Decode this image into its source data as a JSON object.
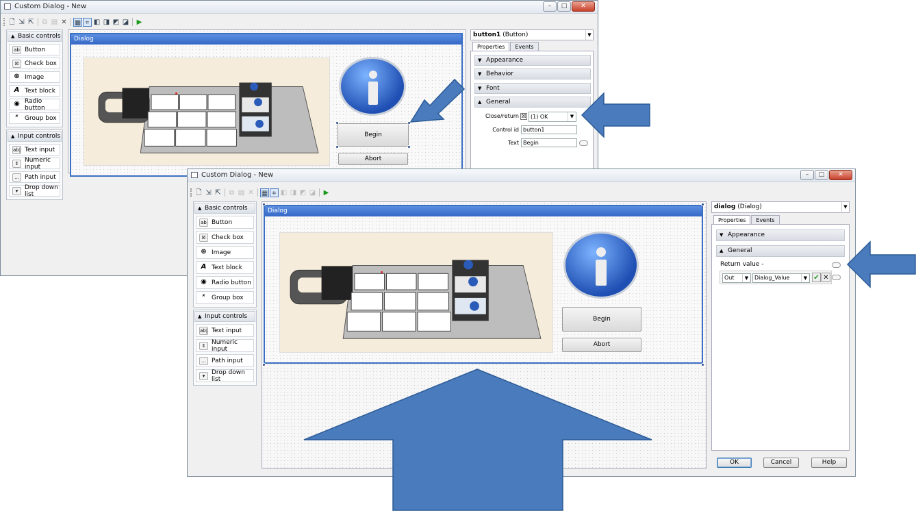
{
  "window1": {
    "title": "Custom Dialog - New",
    "palette": {
      "basic_header": "Basic controls",
      "basic_items": [
        {
          "icon": "ab",
          "label": "Button"
        },
        {
          "icon": "☒",
          "label": "Check box"
        },
        {
          "icon": "⊛",
          "label": "Image"
        },
        {
          "icon": "A",
          "label": "Text block"
        },
        {
          "icon": "◉",
          "label": "Radio button"
        },
        {
          "icon": "ˣ",
          "label": "Group box"
        }
      ],
      "input_header": "Input controls",
      "input_items": [
        {
          "icon": "ab|",
          "label": "Text input"
        },
        {
          "icon": "⇕",
          "label": "Numeric input"
        },
        {
          "icon": "...",
          "label": "Path input"
        },
        {
          "icon": "▾",
          "label": "Drop down list"
        }
      ]
    },
    "dialog": {
      "title": "Dialog",
      "begin_label": "Begin",
      "abort_label": "Abort"
    },
    "properties": {
      "selector_name": "button1",
      "selector_type": "(Button)",
      "tabs": [
        "Properties",
        "Events"
      ],
      "sections": [
        "Appearance",
        "Behavior",
        "Font",
        "General"
      ],
      "close_return_label": "Close/return",
      "close_return_value": "(1) OK",
      "control_id_label": "Control id",
      "control_id_value": "button1",
      "text_label": "Text",
      "text_value": "Begin"
    }
  },
  "window2": {
    "title": "Custom Dialog - New",
    "palette": {
      "basic_header": "Basic controls",
      "basic_items": [
        {
          "icon": "ab",
          "label": "Button"
        },
        {
          "icon": "☒",
          "label": "Check box"
        },
        {
          "icon": "⊛",
          "label": "Image"
        },
        {
          "icon": "A",
          "label": "Text block"
        },
        {
          "icon": "◉",
          "label": "Radio button"
        },
        {
          "icon": "ˣ",
          "label": "Group box"
        }
      ],
      "input_header": "Input controls",
      "input_items": [
        {
          "icon": "ab|",
          "label": "Text input"
        },
        {
          "icon": "⇕",
          "label": "Numeric input"
        },
        {
          "icon": "...",
          "label": "Path input"
        },
        {
          "icon": "▾",
          "label": "Drop down list"
        }
      ]
    },
    "dialog": {
      "title": "Dialog",
      "begin_label": "Begin",
      "abort_label": "Abort"
    },
    "properties": {
      "selector_name": "dialog",
      "selector_type": "(Dialog)",
      "tabs": [
        "Properties",
        "Events"
      ],
      "sections": [
        "Appearance",
        "General"
      ],
      "return_value_label": "Return value",
      "return_value_suffix": "-",
      "direction_value": "Out",
      "variable_value": "Dialog_Value"
    },
    "buttons": {
      "ok": "OK",
      "cancel": "Cancel",
      "help": "Help"
    }
  },
  "icons": {
    "palette_collapse": "caret-up-icon",
    "info": "info-icon",
    "run": "play-icon"
  },
  "colors": {
    "arrow_fill": "#4a7bbd",
    "arrow_stroke": "#2c5b96",
    "dialog_header": "#3a6fc4"
  }
}
